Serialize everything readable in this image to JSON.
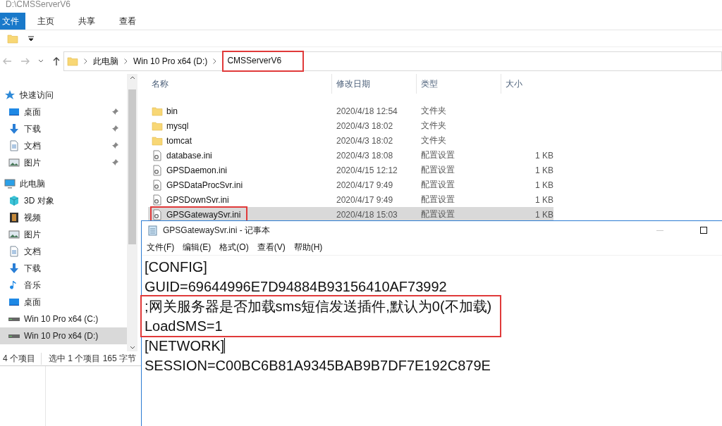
{
  "explorer": {
    "title": "D:\\CMSServerV6",
    "ribbon_tabs": [
      {
        "label": "文件",
        "kind": "file_menu"
      },
      {
        "label": "主页",
        "kind": "tab"
      },
      {
        "label": "共享",
        "kind": "tab"
      },
      {
        "label": "查看",
        "kind": "tab"
      }
    ],
    "address": [
      {
        "label": "此电脑",
        "highlighted": false
      },
      {
        "label": "Win 10 Pro x64 (D:)",
        "highlighted": false
      },
      {
        "label": "CMSServerV6",
        "highlighted": true
      }
    ],
    "sidebar": [
      {
        "label": "快速访问",
        "kind": "star",
        "pinned": false,
        "selected": false
      },
      {
        "label": "桌面",
        "kind": "desktop",
        "pinned": true,
        "selected": false
      },
      {
        "label": "下载",
        "kind": "download",
        "pinned": true,
        "selected": false
      },
      {
        "label": "文档",
        "kind": "document",
        "pinned": true,
        "selected": false
      },
      {
        "label": "图片",
        "kind": "picture",
        "pinned": true,
        "selected": false
      },
      {
        "label": "此电脑",
        "kind": "pc",
        "pinned": false,
        "selected": false
      },
      {
        "label": "3D 对象",
        "kind": "cube",
        "pinned": false,
        "selected": false
      },
      {
        "label": "视频",
        "kind": "video",
        "pinned": false,
        "selected": false
      },
      {
        "label": "图片",
        "kind": "picture",
        "pinned": false,
        "selected": false
      },
      {
        "label": "文档",
        "kind": "document",
        "pinned": false,
        "selected": false
      },
      {
        "label": "下载",
        "kind": "download",
        "pinned": false,
        "selected": false
      },
      {
        "label": "音乐",
        "kind": "music",
        "pinned": false,
        "selected": false
      },
      {
        "label": "桌面",
        "kind": "desktop",
        "pinned": false,
        "selected": false
      },
      {
        "label": "Win 10 Pro x64 (C:)",
        "kind": "drive",
        "pinned": false,
        "selected": false
      },
      {
        "label": "Win 10 Pro x64 (D:)",
        "kind": "drive",
        "pinned": false,
        "selected": true
      }
    ],
    "columns": [
      "名称",
      "修改日期",
      "类型",
      "大小"
    ],
    "files": [
      {
        "name": "bin",
        "date": "2020/4/18 12:54",
        "type": "文件夹",
        "kind": "folder",
        "selected": false,
        "highlighted": false
      },
      {
        "name": "mysql",
        "date": "2020/4/3 18:02",
        "type": "文件夹",
        "kind": "folder",
        "selected": false,
        "highlighted": false
      },
      {
        "name": "tomcat",
        "date": "2020/4/3 18:02",
        "type": "文件夹",
        "kind": "folder",
        "selected": false,
        "highlighted": false
      },
      {
        "name": "database.ini",
        "date": "2020/4/3 18:08",
        "type": "配置设置",
        "size": "1 KB",
        "kind": "file",
        "selected": false,
        "highlighted": false
      },
      {
        "name": "GPSDaemon.ini",
        "date": "2020/4/15 12:12",
        "type": "配置设置",
        "size": "1 KB",
        "kind": "file",
        "selected": false,
        "highlighted": false
      },
      {
        "name": "GPSDataProcSvr.ini",
        "date": "2020/4/17 9:49",
        "type": "配置设置",
        "size": "1 KB",
        "kind": "file",
        "selected": false,
        "highlighted": false
      },
      {
        "name": "GPSDownSvr.ini",
        "date": "2020/4/17 9:49",
        "type": "配置设置",
        "size": "1 KB",
        "kind": "file",
        "selected": false,
        "highlighted": false
      },
      {
        "name": "GPSGatewaySvr.ini",
        "date": "2020/4/18 15:03",
        "type": "配置设置",
        "size": "1 KB",
        "kind": "file",
        "selected": true,
        "highlighted": true
      }
    ],
    "status": [
      "4 个项目",
      "选中 1 个项目  165 字节"
    ]
  },
  "notepad": {
    "title": "GPSGatewaySvr.ini - 记事本",
    "menu": [
      "文件(F)",
      "编辑(E)",
      "格式(O)",
      "查看(V)",
      "帮助(H)"
    ],
    "lines": [
      {
        "text": "[CONFIG]",
        "highlighted": false
      },
      {
        "text": "GUID=69644996E7D94884B93156410AF73992",
        "highlighted": false
      },
      {
        "text": ";网关服务器是否加载sms短信发送插件,默认为0(不加载)",
        "highlighted": true
      },
      {
        "text": "LoadSMS=1",
        "highlighted": true
      },
      {
        "text": "[NETWORK]",
        "highlighted": false
      },
      {
        "text": "SESSION=C00BC6B81A9345BAB9B7DF7E192C879E",
        "highlighted": false
      }
    ]
  }
}
